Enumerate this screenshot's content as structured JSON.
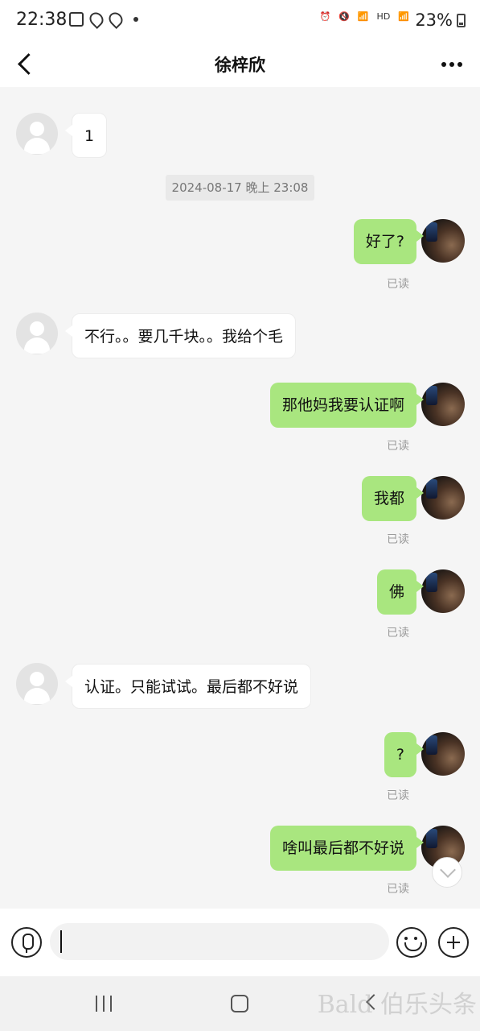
{
  "status_bar": {
    "time": "22:38",
    "battery": "23%",
    "network_labels": [
      "HD"
    ]
  },
  "header": {
    "title": "徐梓欣"
  },
  "timestamp_divider": "2024-08-17 晚上 23:08",
  "messages": [
    {
      "side": "left",
      "text": "1"
    },
    {
      "side": "right",
      "text": "好了?",
      "status": "已读"
    },
    {
      "side": "left",
      "text": "不行。。要几千块。。我给个毛"
    },
    {
      "side": "right",
      "text": "那他妈我要认证啊",
      "status": "已读"
    },
    {
      "side": "right",
      "text": "我都",
      "status": "已读"
    },
    {
      "side": "right",
      "text": "佛",
      "status": "已读"
    },
    {
      "side": "left",
      "text": "认证。只能试试。最后都不好说"
    },
    {
      "side": "right",
      "text": "?",
      "status": "已读"
    },
    {
      "side": "right",
      "text": "啥叫最后都不好说",
      "status": "已读"
    }
  ],
  "input": {
    "value": ""
  },
  "watermark": "Bald 伯乐头条"
}
